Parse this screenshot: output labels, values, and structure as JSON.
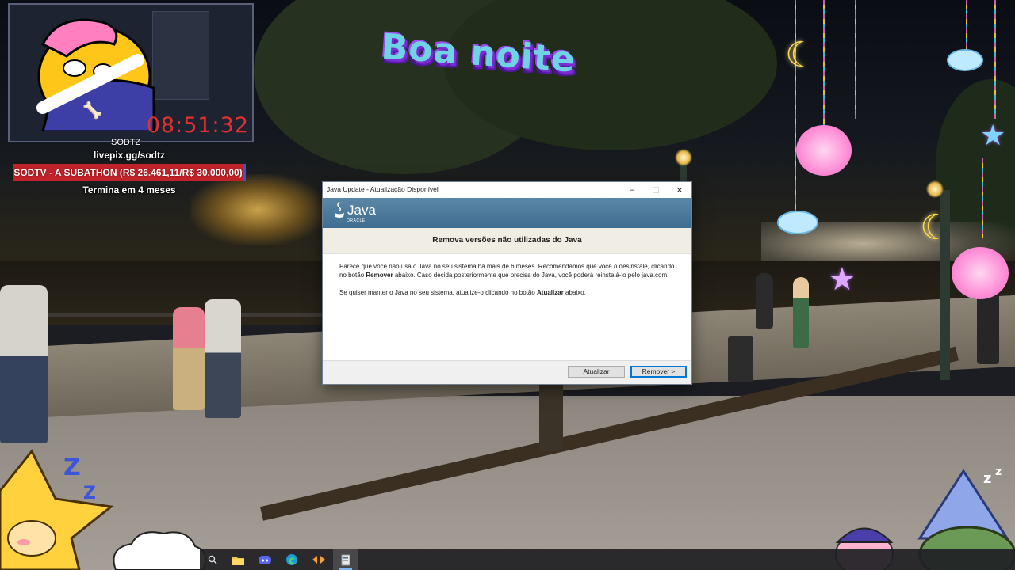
{
  "stream": {
    "timer": "08:51:32",
    "cam_name": "SODTZ",
    "livepix": "livepix.gg/sodtz",
    "goal": "SODTV - A SUBATHON (R$ 26.461,11/R$ 30.000,00)",
    "goal_progress": 0.882,
    "ends_in": "Termina em 4 meses",
    "greeting": "Boa noite"
  },
  "dialog": {
    "title": "Java Update - Atualização Disponível",
    "brand": "Java",
    "brand_sub": "ORACLE",
    "heading": "Remova versões não utilizadas do Java",
    "para1_a": "Parece que você não usa o Java no seu sistema há mais de 6 meses. Recomendamos que você o desinstale, clicando no botão ",
    "para1_bold": "Remover",
    "para1_b": " abaixo. Caso decida posteriormente que precisa do Java, você poderá reinstalá-lo pelo java.com.",
    "para2_a": "Se quiser manter o Java no seu sistema, atualize-o clicando no botão ",
    "para2_bold": "Atualizar",
    "para2_b": " abaixo.",
    "update_button": "Atualizar",
    "remove_button": "Remover >",
    "controls": {
      "minimize": "–",
      "maximize": "☐",
      "close": "✕"
    }
  },
  "taskbar": {
    "apps": [
      "search-icon",
      "file-explorer-icon",
      "discord-icon",
      "edge-icon",
      "app-arrows-icon",
      "java-update-icon"
    ],
    "active_app": "java-update-icon"
  },
  "colors": {
    "timer": "#e03131",
    "goal_bar": "#c0242a",
    "java_banner": "#4c7b9e",
    "primary_button_border": "#0078d7"
  }
}
